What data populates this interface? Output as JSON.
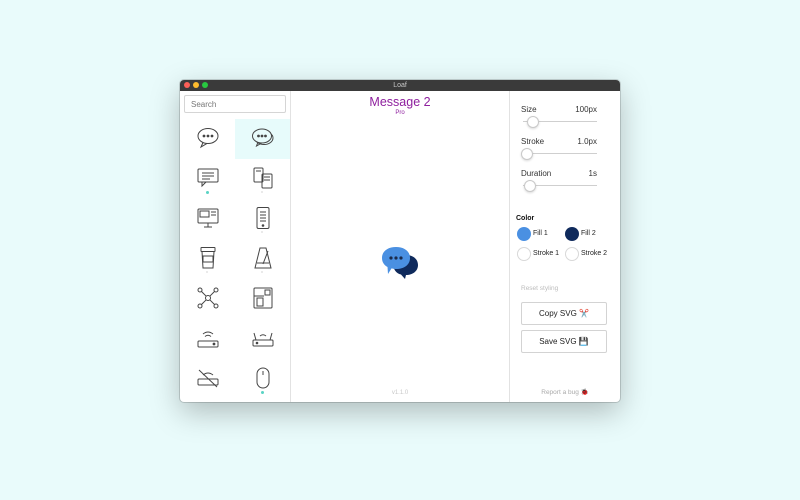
{
  "window": {
    "title": "Loaf"
  },
  "sidebar": {
    "search_placeholder": "Search",
    "icons": [
      {
        "name": "message-1-icon",
        "mark": "none",
        "selected": false
      },
      {
        "name": "message-2-icon",
        "mark": "none",
        "selected": true
      },
      {
        "name": "chat-bubble-icon",
        "mark": "teal",
        "selected": false
      },
      {
        "name": "devices-sync-icon",
        "mark": "gray",
        "selected": false
      },
      {
        "name": "computer-stack-icon",
        "mark": "none",
        "selected": false
      },
      {
        "name": "mobile-phone-icon",
        "mark": "gray",
        "selected": false
      },
      {
        "name": "coffee-cup-icon",
        "mark": "gray",
        "selected": false
      },
      {
        "name": "metronome-icon",
        "mark": "gray",
        "selected": false
      },
      {
        "name": "network-nodes-icon",
        "mark": "none",
        "selected": false
      },
      {
        "name": "coffee-machine-icon",
        "mark": "none",
        "selected": false
      },
      {
        "name": "wifi-router-icon",
        "mark": "none",
        "selected": false
      },
      {
        "name": "router-icon",
        "mark": "none",
        "selected": false
      },
      {
        "name": "router-off-icon",
        "mark": "none",
        "selected": false
      },
      {
        "name": "mouse-icon",
        "mark": "teal",
        "selected": false
      },
      {
        "name": "clock-icon",
        "mark": "none",
        "selected": false
      }
    ]
  },
  "preview": {
    "icon_name": "Message 2",
    "badge": "Pro",
    "version": "v1.1.0",
    "fill1_color": "#4a90e2",
    "fill2_color": "#0f2a5c"
  },
  "controls": {
    "size": {
      "label": "Size",
      "value": "100px",
      "fraction": 0.1
    },
    "stroke": {
      "label": "Stroke",
      "value": "1.0px",
      "fraction": 0.0
    },
    "duration": {
      "label": "Duration",
      "value": "1s",
      "fraction": 0.05
    },
    "color_heading": "Color",
    "swatches": [
      {
        "label": "Fill 1",
        "color": "#4a90e2"
      },
      {
        "label": "Fill 2",
        "color": "#0f2a5c"
      },
      {
        "label": "Stroke 1",
        "color": ""
      },
      {
        "label": "Stroke 2",
        "color": ""
      }
    ],
    "reset_label": "Reset styling",
    "copy_label": "Copy SVG ✂️",
    "save_label": "Save SVG 💾",
    "report_label": "Report a bug 🐞"
  }
}
